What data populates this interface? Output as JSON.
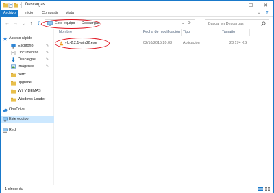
{
  "window": {
    "title": "Descargas",
    "controls": {
      "minimize": "—",
      "maximize": "☐",
      "close": "✕"
    }
  },
  "ribbon": {
    "tabs": [
      "Archivo",
      "Inicio",
      "Compartir",
      "Vista"
    ],
    "expand": "⌄",
    "help": "?"
  },
  "navigation": {
    "back": "←",
    "forward": "→",
    "recent": "⌄",
    "up": "↑",
    "breadcrumb": [
      "Este equipo",
      "Descargas"
    ],
    "separator": "›",
    "refresh": "⟳",
    "search_placeholder": "Buscar en Descargas"
  },
  "sidebar": {
    "items": [
      {
        "label": "Acceso rápido",
        "icon": "star-icon",
        "pinned": false
      },
      {
        "label": "Escritorio",
        "icon": "desktop-icon",
        "pinned": true
      },
      {
        "label": "Documentos",
        "icon": "documents-icon",
        "pinned": true
      },
      {
        "label": "Descargas",
        "icon": "downloads-icon",
        "pinned": true
      },
      {
        "label": "Imágenes",
        "icon": "pictures-icon",
        "pinned": true
      },
      {
        "label": "netfx",
        "icon": "folder-icon",
        "pinned": false
      },
      {
        "label": "upgrade",
        "icon": "folder-icon",
        "pinned": false
      },
      {
        "label": "W7 Y DEMAS",
        "icon": "folder-icon",
        "pinned": false
      },
      {
        "label": "Windows Loader",
        "icon": "folder-icon",
        "pinned": false
      },
      {
        "label": "OneDrive",
        "icon": "cloud-icon",
        "pinned": false
      },
      {
        "label": "Este equipo",
        "icon": "computer-icon",
        "pinned": false,
        "selected": true
      },
      {
        "label": "Red",
        "icon": "network-icon",
        "pinned": false
      }
    ],
    "pin_glyph": "✎"
  },
  "columns": [
    "Nombre",
    "Fecha de modificación",
    "Tipo",
    "Tamaño"
  ],
  "files": [
    {
      "name": "vlc-2.2.1-win32.exe",
      "date": "02/10/2015 20:03",
      "type": "Aplicación",
      "size": "23.174 KB"
    }
  ],
  "status": {
    "text": "1 elemento"
  },
  "colors": {
    "accent": "#1979ca",
    "annotation": "#e0101c",
    "selection": "#cce8ff",
    "folder": "#e8bf4b"
  }
}
